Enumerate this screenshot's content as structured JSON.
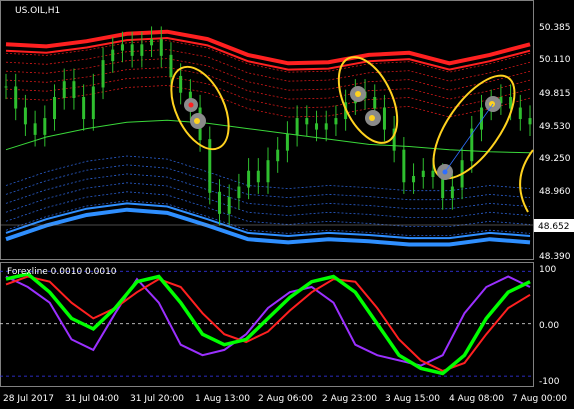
{
  "chart_title": "US.OIL,H1",
  "indicator_label": "Forexline 0.0010 0.0010",
  "price_axis": {
    "ticks": [
      "50.385",
      "50.110",
      "49.815",
      "49.530",
      "49.250",
      "48.960",
      "48.390"
    ],
    "current_price": "48.652",
    "range": [
      48.3,
      50.55
    ]
  },
  "osc_axis": {
    "ticks": [
      "100",
      "0.00",
      "-100"
    ],
    "range": [
      -115,
      110
    ]
  },
  "time_axis": {
    "ticks": [
      "28 Jul 2017",
      "31 Jul 04:00",
      "31 Jul 20:00",
      "1 Aug 13:00",
      "2 Aug 06:00",
      "2 Aug 23:00",
      "3 Aug 15:00",
      "4 Aug 08:00",
      "7 Aug 00:00"
    ]
  },
  "colors": {
    "background": "#000000",
    "candles": "#2fbf2f",
    "ma_line": "#3ad83a",
    "upper_band": "#ff2020",
    "upper_inner": "#d01818",
    "lower_band": "#2f8fff",
    "lower_inner": "#2a5fd0",
    "highlight": "#ffd21f",
    "osc_green": "#00ff00",
    "osc_red": "#ff2020",
    "osc_purple": "#9b30ff",
    "osc_band": "#3a3aff",
    "axis": "#ffffff"
  },
  "chart_data": {
    "type": "line",
    "title": "US.OIL,H1",
    "close": [
      49.9,
      49.7,
      49.55,
      49.45,
      49.6,
      49.8,
      49.95,
      49.8,
      49.6,
      49.9,
      50.15,
      50.25,
      50.3,
      50.2,
      50.3,
      50.35,
      50.2,
      50.0,
      49.85,
      49.7,
      49.4,
      48.9,
      48.7,
      48.85,
      48.95,
      49.1,
      49.0,
      49.2,
      49.3,
      49.45,
      49.6,
      49.55,
      49.5,
      49.55,
      49.6,
      49.75,
      49.85,
      49.8,
      49.7,
      49.5,
      49.3,
      49.0,
      49.05,
      49.1,
      49.05,
      48.85,
      48.95,
      49.2,
      49.5,
      49.7,
      49.75,
      49.8,
      49.7,
      49.6,
      49.55
    ],
    "ma": [
      49.3,
      49.42,
      49.5,
      49.56,
      49.58,
      49.55,
      49.5,
      49.45,
      49.4,
      49.35,
      49.33,
      49.3,
      49.28,
      49.27
    ],
    "upper_band": [
      50.3,
      50.28,
      50.33,
      50.4,
      50.42,
      50.35,
      50.2,
      50.12,
      50.13,
      50.2,
      50.22,
      50.12,
      50.2,
      50.3
    ],
    "lower_band": [
      48.45,
      48.58,
      48.68,
      48.73,
      48.7,
      48.58,
      48.45,
      48.42,
      48.45,
      48.43,
      48.4,
      48.4,
      48.45,
      48.42
    ],
    "osc_green": [
      85,
      95,
      60,
      10,
      -10,
      30,
      80,
      90,
      40,
      -20,
      -40,
      -30,
      10,
      50,
      80,
      90,
      60,
      0,
      -60,
      -85,
      -95,
      -60,
      10,
      60,
      80
    ],
    "osc_red": [
      75,
      90,
      80,
      40,
      10,
      30,
      60,
      85,
      70,
      20,
      -20,
      -35,
      -15,
      25,
      60,
      85,
      80,
      30,
      -30,
      -70,
      -90,
      -75,
      -20,
      30,
      55
    ],
    "osc_purple": [
      90,
      70,
      40,
      -30,
      -50,
      20,
      85,
      40,
      -40,
      -60,
      -50,
      -20,
      30,
      60,
      70,
      40,
      -40,
      -60,
      -70,
      -80,
      -60,
      20,
      70,
      90,
      70
    ]
  }
}
